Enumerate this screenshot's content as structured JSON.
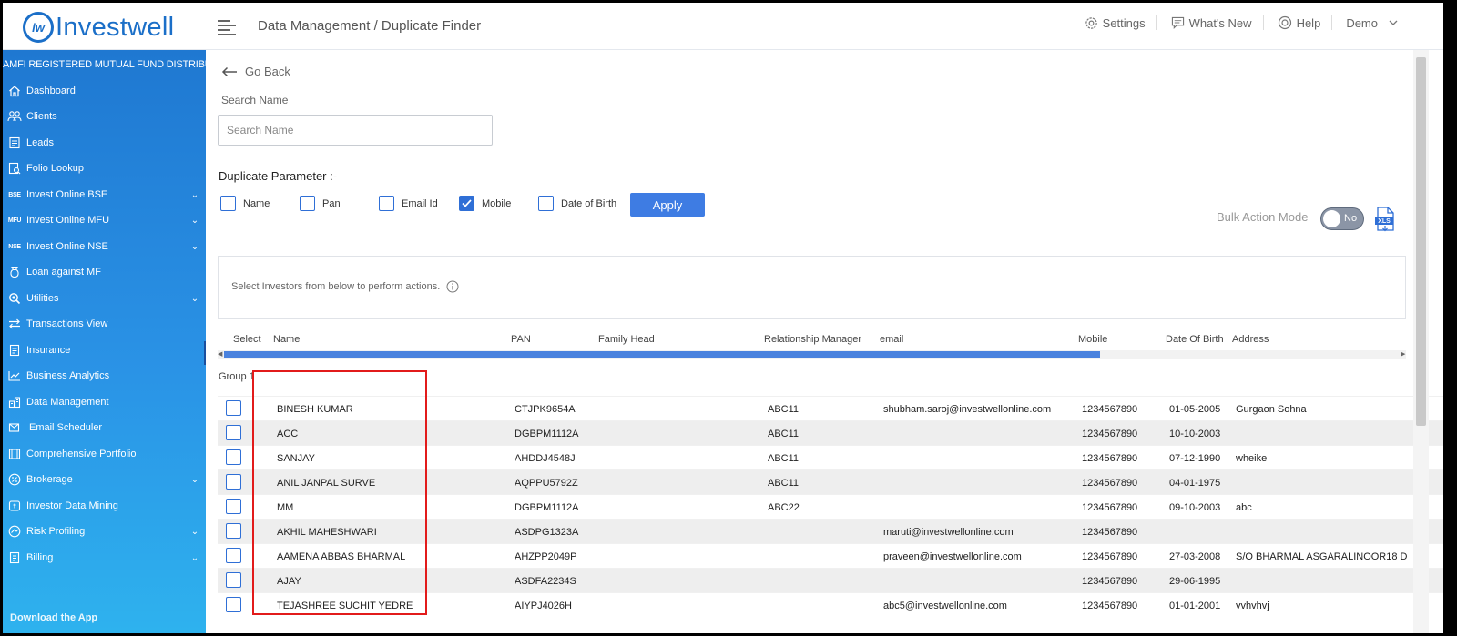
{
  "brand": {
    "logo_mark": "iw",
    "logo_text": "Investwell"
  },
  "header": {
    "breadcrumb": "Data Management / Duplicate Finder",
    "settings_label": "Settings",
    "whats_new_label": "What's New",
    "help_label": "Help",
    "user_label": "Demo"
  },
  "sidebar": {
    "heading": "AMFI REGISTERED MUTUAL FUND DISTRIBUTOR",
    "items": [
      {
        "label": "Dashboard",
        "icon": "home-icon",
        "expandable": false
      },
      {
        "label": "Clients",
        "icon": "users-icon",
        "expandable": false
      },
      {
        "label": "Leads",
        "icon": "leads-icon",
        "expandable": false
      },
      {
        "label": "Folio Lookup",
        "icon": "folio-icon",
        "expandable": false
      },
      {
        "label": "Invest Online BSE",
        "mini": "BSE",
        "expandable": true
      },
      {
        "label": "Invest Online MFU",
        "mini": "MFU",
        "expandable": true
      },
      {
        "label": "Invest Online NSE",
        "mini": "NSE",
        "expandable": true
      },
      {
        "label": "Loan against MF",
        "icon": "loan-icon",
        "expandable": false
      },
      {
        "label": "Utilities",
        "icon": "utilities-icon",
        "expandable": true
      },
      {
        "label": "Transactions View",
        "icon": "transactions-icon",
        "expandable": false
      },
      {
        "label": "Insurance",
        "icon": "insurance-icon",
        "expandable": false
      },
      {
        "label": "Business Analytics",
        "icon": "analytics-icon",
        "expandable": false
      },
      {
        "label": "Data Management",
        "icon": "data-icon",
        "expandable": false
      },
      {
        "label": "Email Scheduler",
        "icon": "email-icon",
        "expandable": false
      },
      {
        "label": "Comprehensive Portfolio",
        "icon": "portfolio-icon",
        "expandable": false
      },
      {
        "label": "Brokerage",
        "icon": "brokerage-icon",
        "expandable": true
      },
      {
        "label": "Investor Data Mining",
        "icon": "mining-icon",
        "expandable": false
      },
      {
        "label": "Risk Profiling",
        "icon": "risk-icon",
        "expandable": true
      },
      {
        "label": "Billing",
        "icon": "billing-icon",
        "expandable": true
      }
    ],
    "bottom_text": "Download the App"
  },
  "main": {
    "go_back": "Go Back",
    "search_label": "Search Name",
    "search_placeholder": "Search Name",
    "duplicate_title": "Duplicate Parameter :-",
    "params": [
      {
        "label": "Name",
        "checked": false
      },
      {
        "label": "Pan",
        "checked": false
      },
      {
        "label": "Email Id",
        "checked": false
      },
      {
        "label": "Mobile",
        "checked": true
      },
      {
        "label": "Date of Birth",
        "checked": false
      }
    ],
    "apply_label": "Apply",
    "bulk_action_label": "Bulk Action Mode",
    "bulk_toggle_value": "No",
    "xls_label": "XLS",
    "info_text": "Select Investors from below to perform actions.",
    "group_label": "Group 1"
  },
  "table": {
    "columns": [
      "Select",
      "Name",
      "PAN",
      "Family Head",
      "Relationship Manager",
      "email",
      "Mobile",
      "Date Of Birth",
      "Address"
    ],
    "rows": [
      {
        "name": "BINESH KUMAR",
        "pan": "CTJPK9654A",
        "rm": "ABC11",
        "email": "shubham.saroj@investwellonline.com",
        "mobile": "1234567890",
        "dob": "01-05-2005",
        "address": "Gurgaon Sohna"
      },
      {
        "name": "ACC",
        "pan": "DGBPM1112A",
        "rm": "ABC11",
        "email": "",
        "mobile": "1234567890",
        "dob": "10-10-2003",
        "address": ""
      },
      {
        "name": "SANJAY",
        "pan": "AHDDJ4548J",
        "rm": "ABC11",
        "email": "",
        "mobile": "1234567890",
        "dob": "07-12-1990",
        "address": "wheike"
      },
      {
        "name": "ANIL JANPAL SURVE",
        "pan": "AQPPU5792Z",
        "rm": "ABC11",
        "email": "",
        "mobile": "1234567890",
        "dob": "04-01-1975",
        "address": ""
      },
      {
        "name": "MM",
        "pan": "DGBPM1112A",
        "rm": "ABC22",
        "email": "",
        "mobile": "1234567890",
        "dob": "09-10-2003",
        "address": "abc"
      },
      {
        "name": "AKHIL MAHESHWARI",
        "pan": "ASDPG1323A",
        "rm": "",
        "email": "maruti@investwellonline.com",
        "mobile": "1234567890",
        "dob": "",
        "address": ""
      },
      {
        "name": "AAMENA ABBAS BHARMAL",
        "pan": "AHZPP2049P",
        "rm": "",
        "email": "praveen@investwellonline.com",
        "mobile": "1234567890",
        "dob": "27-03-2008",
        "address": "S/O BHARMAL ASGARALINOOR18 D"
      },
      {
        "name": "AJAY",
        "pan": "ASDFA2234S",
        "rm": "",
        "email": "",
        "mobile": "1234567890",
        "dob": "29-06-1995",
        "address": ""
      },
      {
        "name": "TEJASHREE SUCHIT YEDRE",
        "pan": "AIYPJ4026H",
        "rm": "",
        "email": "abc5@investwellonline.com",
        "mobile": "1234567890",
        "dob": "01-01-2001",
        "address": "vvhvhvj"
      }
    ]
  },
  "colors": {
    "brand": "#1b6fc8",
    "sidebar_top": "#1f78d1",
    "sidebar_bottom": "#2eb2ee",
    "accent": "#3e7ce3",
    "highlight": "#e21b1b"
  }
}
